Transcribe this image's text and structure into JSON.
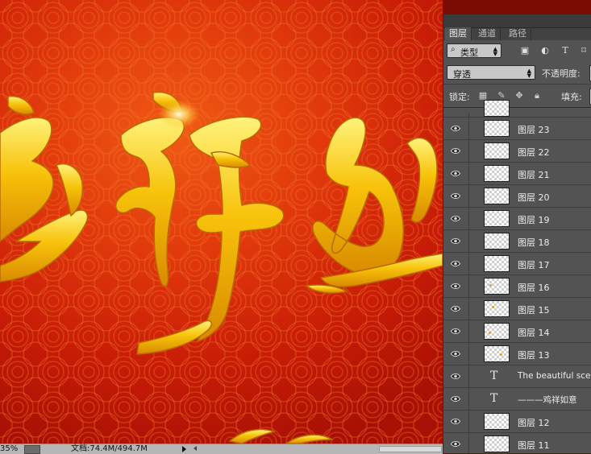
{
  "panel": {
    "tabs": [
      {
        "label": "图层",
        "active": true
      },
      {
        "label": "通道",
        "active": false
      },
      {
        "label": "路径",
        "active": false
      }
    ],
    "filter_kind": "类型",
    "filter_icons": [
      "image-filter-icon",
      "adjustment-filter-icon",
      "type-filter-icon",
      "shape-filter-icon"
    ],
    "blend_mode": "穿透",
    "opacity_label": "不透明度:",
    "lock_label": "锁定:",
    "lock_icons": [
      "lock-transparent-icon",
      "lock-image-icon",
      "lock-position-icon",
      "lock-all-icon"
    ],
    "fill_label": "填充:",
    "layers": [
      {
        "name": "图层 23",
        "kind": "pixel",
        "dot": false
      },
      {
        "name": "图层 22",
        "kind": "pixel",
        "dot": false
      },
      {
        "name": "图层 21",
        "kind": "pixel",
        "dot": false
      },
      {
        "name": "图层 20",
        "kind": "pixel",
        "dot": false
      },
      {
        "name": "图层 19",
        "kind": "pixel",
        "dot": false
      },
      {
        "name": "图层 18",
        "kind": "pixel",
        "dot": false
      },
      {
        "name": "图层 17",
        "kind": "pixel",
        "dot": false
      },
      {
        "name": "图层 16",
        "kind": "pixel",
        "dot": true
      },
      {
        "name": "图层 15",
        "kind": "pixel",
        "dot": true
      },
      {
        "name": "图层 14",
        "kind": "pixel",
        "dot": true
      },
      {
        "name": "图层 13",
        "kind": "pixel",
        "dot": true
      },
      {
        "name": "The beautiful scen",
        "kind": "text",
        "dot": false
      },
      {
        "name": "———鸡祥如意",
        "kind": "text",
        "dot": false
      },
      {
        "name": "图层 12",
        "kind": "pixel",
        "dot": false
      },
      {
        "name": "图层 11",
        "kind": "pixel",
        "dot": false
      }
    ]
  },
  "status": {
    "zoom": "35%",
    "doc_info": "文档:74.4M/494.7M"
  },
  "colors": {
    "canvas_bg": "#d42c08",
    "calligraphy_gold": "#f7c20a",
    "panel_bg": "#535353"
  }
}
